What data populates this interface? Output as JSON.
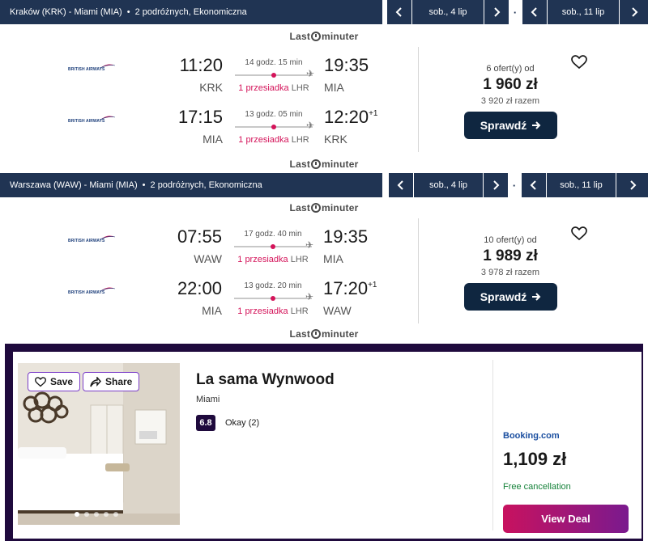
{
  "searches": [
    {
      "route": "Kraków (KRK) - Miami (MIA)",
      "details": "2 podróżnych, Ekonomiczna",
      "depart_date": "sob., 4 lip",
      "return_date": "sob., 11 lip",
      "separator": "·"
    },
    {
      "route": "Warszawa (WAW) - Miami (MIA)",
      "details": "2 podróżnych, Ekonomiczna",
      "depart_date": "sob., 4 lip",
      "return_date": "sob., 11 lip",
      "separator": "·"
    }
  ],
  "logo": {
    "left": "Last",
    "right": "minuter"
  },
  "flights": [
    {
      "legs": [
        {
          "airline": "BRITISH AIRWAYS",
          "dep_time": "11:20",
          "arr_time": "19:35",
          "arr_plus": "",
          "dep_code": "KRK",
          "arr_code": "MIA",
          "duration": "14 godz. 15 min",
          "stops": "1 przesiadka",
          "via": "LHR"
        },
        {
          "airline": "BRITISH AIRWAYS",
          "dep_time": "17:15",
          "arr_time": "12:20",
          "arr_plus": "+1",
          "dep_code": "MIA",
          "arr_code": "KRK",
          "duration": "13 godz. 05 min",
          "stops": "1 przesiadka",
          "via": "LHR"
        }
      ],
      "offers": "6 ofert(y) od",
      "price": "1 960 zł",
      "total": "3 920 zł razem",
      "button": "Sprawdź"
    },
    {
      "legs": [
        {
          "airline": "BRITISH AIRWAYS",
          "dep_time": "07:55",
          "arr_time": "19:35",
          "arr_plus": "",
          "dep_code": "WAW",
          "arr_code": "MIA",
          "duration": "17 godz. 40 min",
          "stops": "1 przesiadka",
          "via": "LHR"
        },
        {
          "airline": "BRITISH AIRWAYS",
          "dep_time": "22:00",
          "arr_time": "17:20",
          "arr_plus": "+1",
          "dep_code": "MIA",
          "arr_code": "WAW",
          "duration": "13 godz. 20 min",
          "stops": "1 przesiadka",
          "via": "LHR"
        }
      ],
      "offers": "10 ofert(y) od",
      "price": "1 989 zł",
      "total": "3 978 zł razem",
      "button": "Sprawdź"
    }
  ],
  "hotel": {
    "save_label": "Save",
    "share_label": "Share",
    "name": "La sama Wynwood",
    "city": "Miami",
    "rating": "6.8",
    "rating_text": "Okay (2)",
    "provider": "Booking.com",
    "price": "1,109 zł",
    "cancellation": "Free cancellation",
    "deal_label": "View Deal",
    "image_dots": 5,
    "active_dot": 1
  },
  "colors": {
    "navy": "#203453",
    "button_navy": "#0f2640",
    "stop_red": "#d4145a",
    "hotel_frame": "#1f0a3d",
    "deal_gradient_start": "#c8125f",
    "deal_gradient_end": "#7a1a8e",
    "cancel_green": "#16823a",
    "booking_blue": "#1b4fa0"
  }
}
